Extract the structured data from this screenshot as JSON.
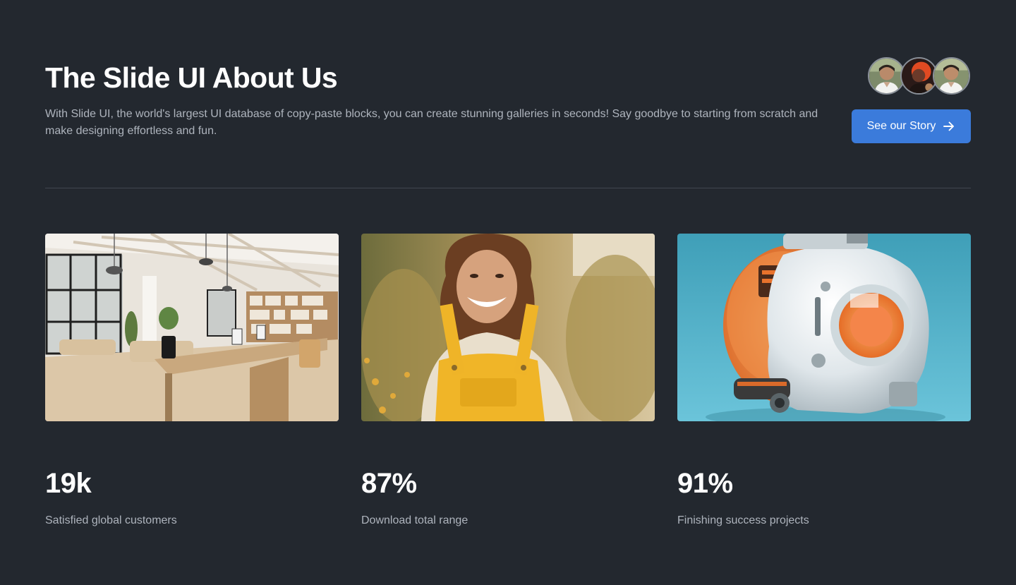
{
  "header": {
    "title": "The Slide UI About Us",
    "description": "With Slide UI, the world's largest UI database of copy-paste blocks, you can create stunning galleries in seconds! Say goodbye to starting from scratch and make designing effortless and fun."
  },
  "cta": {
    "label": "See our Story",
    "icon": "arrow-right-icon",
    "color": "#3b7bdb"
  },
  "avatars": [
    {
      "name": "avatar-1"
    },
    {
      "name": "avatar-2"
    },
    {
      "name": "avatar-3"
    }
  ],
  "stats": [
    {
      "value": "19k",
      "label": "Satisfied global customers",
      "image": "office-interior-photo"
    },
    {
      "value": "87%",
      "label": "Download total range",
      "image": "smiling-woman-photo"
    },
    {
      "value": "91%",
      "label": "Finishing success projects",
      "image": "robot-helmet-photo"
    }
  ],
  "colors": {
    "background": "#23282f",
    "text_primary": "#ffffff",
    "text_secondary": "#aeb4bd",
    "accent": "#3b7bdb"
  }
}
